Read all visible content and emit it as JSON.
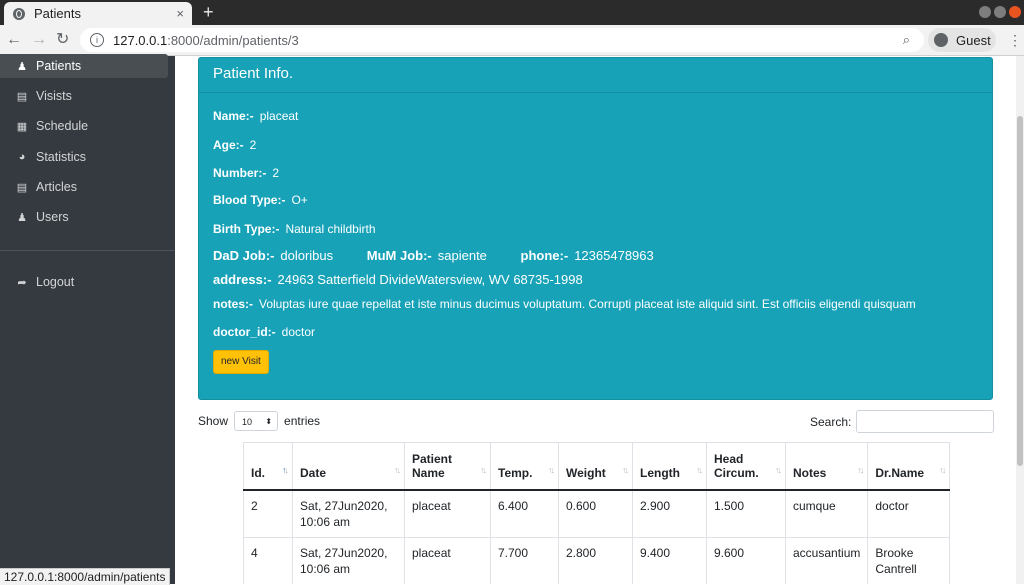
{
  "browser": {
    "tab_title": "Patients",
    "tab_close": "×",
    "new_tab": "+",
    "url_host": "127.0.0.1",
    "url_path": ":8000/admin/patients/3",
    "profile": "Guest",
    "status_url": "127.0.0.1:8000/admin/patients"
  },
  "sidebar": {
    "items": [
      {
        "label": "Patients",
        "icon": "user-injured-icon",
        "glyph": "♟"
      },
      {
        "label": "Visists",
        "icon": "list-icon",
        "glyph": "▤"
      },
      {
        "label": "Schedule",
        "icon": "calendar-icon",
        "glyph": "▦"
      },
      {
        "label": "Statistics",
        "icon": "pie-chart-icon",
        "glyph": "◕"
      },
      {
        "label": "Articles",
        "icon": "newspaper-icon",
        "glyph": "▤"
      },
      {
        "label": "Users",
        "icon": "users-icon",
        "glyph": "♟"
      },
      {
        "label": "Logout",
        "icon": "sign-out-icon",
        "glyph": "➦"
      }
    ]
  },
  "patient": {
    "header": "Patient Info.",
    "name_label": "Name:-",
    "name": "placeat",
    "age_label": "Age:-",
    "age": "2",
    "number_label": "Number:-",
    "number": "2",
    "blood_label": "Blood Type:-",
    "blood": "O+",
    "birth_label": "Birth Type:-",
    "birth": "Natural childbirth",
    "dad_label": "DaD Job:-",
    "dad": "doloribus",
    "mum_label": "MuM Job:-",
    "mum": "sapiente",
    "phone_label": "phone:-",
    "phone": "12365478963",
    "address_label": "address:-",
    "address": "24963 Satterfield DivideWatersview, WV 68735-1998",
    "notes_label": "notes:-",
    "notes": "Voluptas iure quae repellat et iste minus ducimus voluptatum. Corrupti placeat iste aliquid sint. Est officiis eligendi quisquam",
    "doctor_label": "doctor_id:-",
    "doctor": "doctor",
    "new_visit": "new Visit"
  },
  "table_controls": {
    "show": "Show",
    "length": "10",
    "entries": "entries",
    "search": "Search:"
  },
  "colors": {
    "card": "#17a2b8",
    "button": "#ffc107",
    "sidebar": "#343a40"
  },
  "table": {
    "columns": [
      {
        "line1": "Id.",
        "line2": ""
      },
      {
        "line1": "Date",
        "line2": ""
      },
      {
        "line1": "Patient",
        "line2": "Name"
      },
      {
        "line1": "Temp.",
        "line2": ""
      },
      {
        "line1": "Weight",
        "line2": ""
      },
      {
        "line1": "Length",
        "line2": ""
      },
      {
        "line1": "Head",
        "line2": "Circum."
      },
      {
        "line1": "Notes",
        "line2": ""
      },
      {
        "line1": "Dr.Name",
        "line2": ""
      }
    ],
    "rows": [
      [
        "2",
        "Sat, 27Jun2020,",
        "10:06 am",
        "placeat",
        "6.400",
        "0.600",
        "2.900",
        "1.500",
        "cumque",
        "doctor",
        ""
      ],
      [
        "4",
        "Sat, 27Jun2020,",
        "10:06 am",
        "placeat",
        "7.700",
        "2.800",
        "9.400",
        "9.600",
        "accusantium",
        "Brooke",
        "Cantrell"
      ]
    ]
  }
}
